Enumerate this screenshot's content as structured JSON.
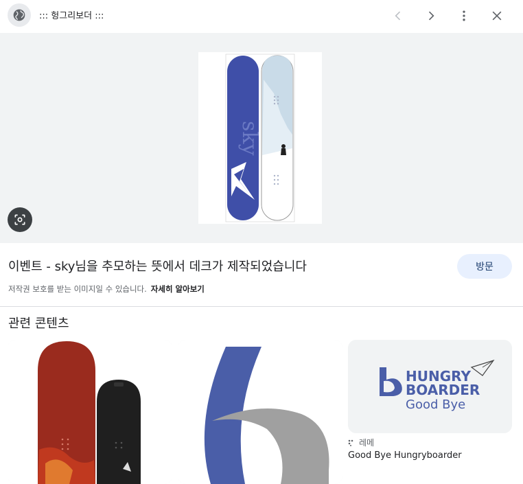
{
  "header": {
    "site_title": "::: 헝그리보더 :::",
    "icons": [
      "globe-icon",
      "chevron-left-icon",
      "chevron-right-icon",
      "more-vert-icon",
      "close-icon"
    ]
  },
  "preview": {
    "board_text": "sky",
    "lens_icon": "lens-icon"
  },
  "details": {
    "title": "이벤트 - sky님을 추모하는 뜻에서 데크가 제작되었습니다",
    "visit_label": "방문",
    "copyright_notice": "저작권 보호를 받는 이미지일 수 있습니다.",
    "learn_more": "자세히 알아보기"
  },
  "related": {
    "heading": "관련 콘텐츠",
    "cards": [
      {},
      {},
      {
        "logo_text_1": "HUNGRY",
        "logo_text_2": "BOARDER",
        "logo_text_3": "Good Bye",
        "source": "레메",
        "title": "Good Bye Hungryboarder"
      }
    ]
  },
  "colors": {
    "accent": "#e8f0fe",
    "board_blue": "#3f4fa8",
    "logo_blue": "#4a5ea8"
  }
}
